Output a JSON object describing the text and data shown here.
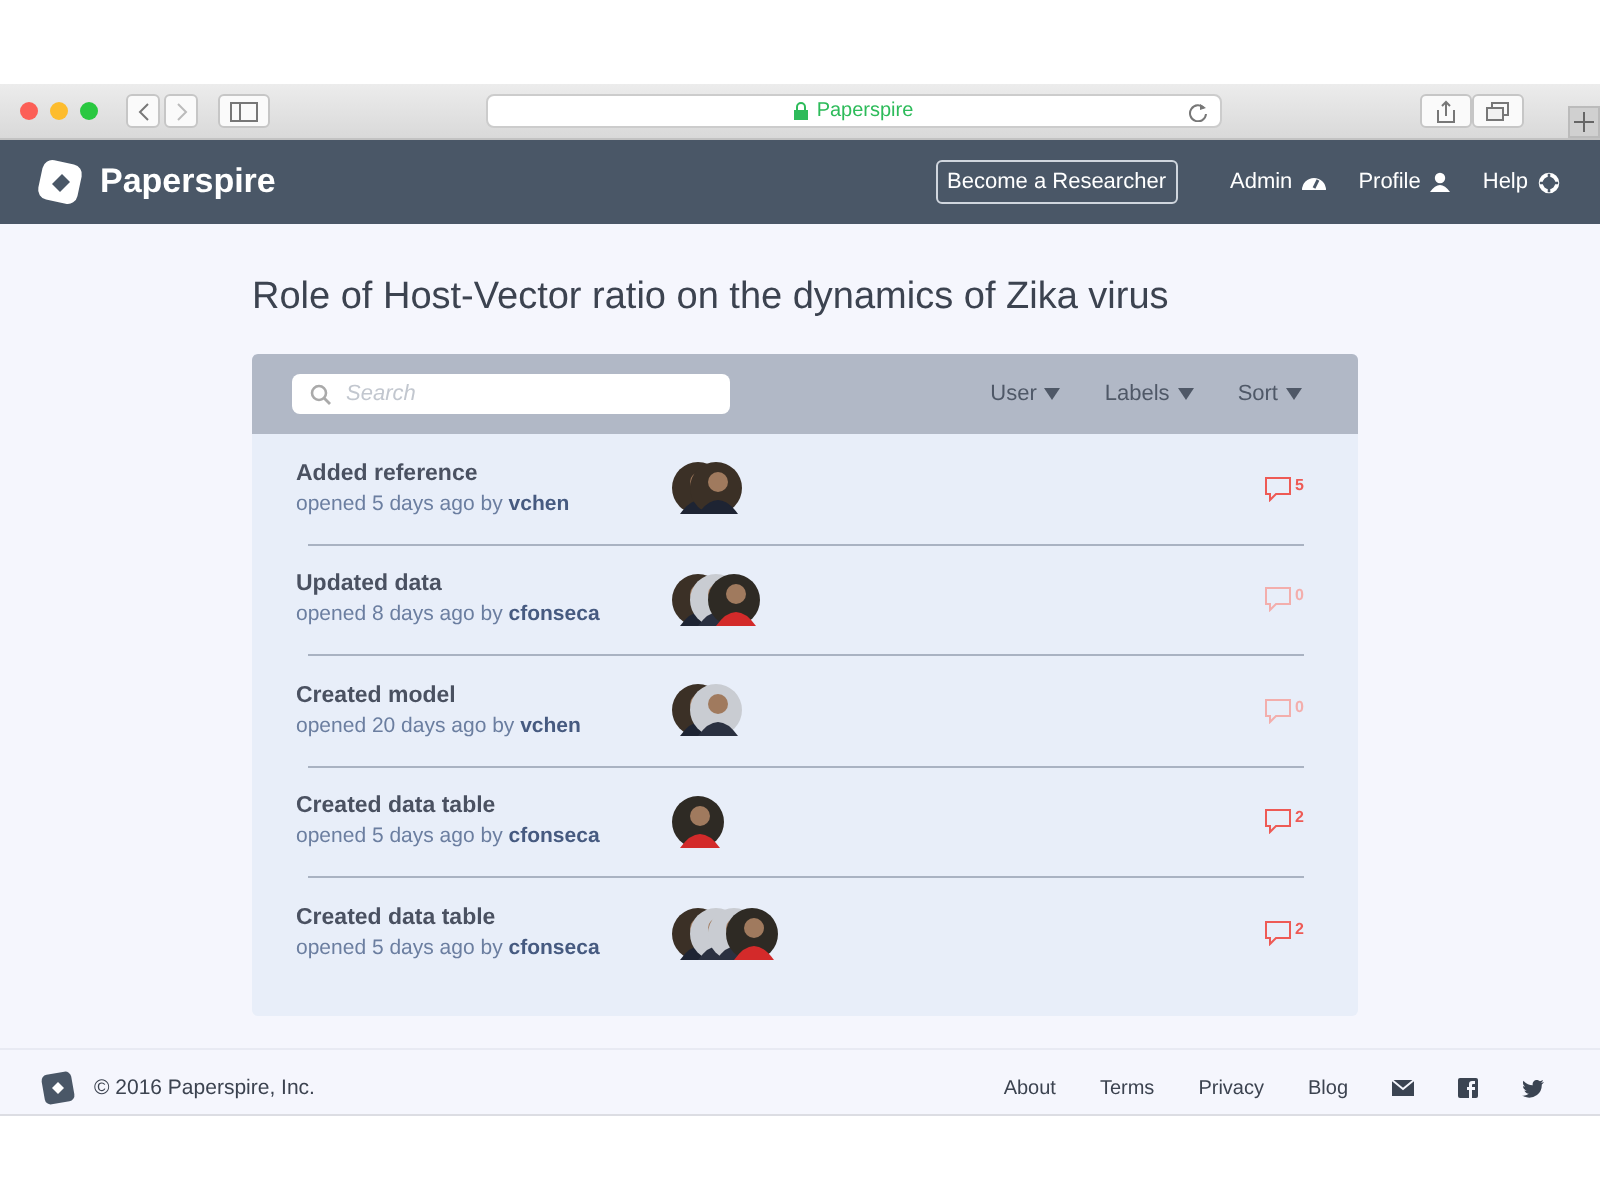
{
  "browser": {
    "address": "Paperspire"
  },
  "navbar": {
    "brand": "Paperspire",
    "cta": "Become a Researcher",
    "links": [
      {
        "label": "Admin",
        "kind": "dashboard"
      },
      {
        "label": "Profile",
        "kind": "user"
      },
      {
        "label": "Help",
        "kind": "lifebuoy"
      }
    ]
  },
  "page": {
    "title": "Role of Host-Vector ratio on the dynamics of Zika virus"
  },
  "toolbar": {
    "search": {
      "placeholder": "Search"
    },
    "filters": [
      "User",
      "Labels",
      "Sort"
    ]
  },
  "activities": [
    {
      "title": "Added reference",
      "meta": "opened 5 days ago by",
      "author": "vchen",
      "avatars": [
        {
          "kind": "dark"
        },
        {
          "kind": "dark"
        }
      ],
      "comments": "5",
      "muted": false
    },
    {
      "title": "Updated data",
      "meta": "opened 8 days ago by",
      "author": "cfonseca",
      "avatars": [
        {
          "kind": "dark"
        },
        {
          "kind": "light"
        },
        {
          "kind": "scarf"
        }
      ],
      "comments": "0",
      "muted": true
    },
    {
      "title": "Created model",
      "meta": "opened 20 days ago by",
      "author": "vchen",
      "avatars": [
        {
          "kind": "dark"
        },
        {
          "kind": "light"
        }
      ],
      "comments": "0",
      "muted": true
    },
    {
      "title": "Created data table",
      "meta": "opened 5 days ago by",
      "author": "cfonseca",
      "avatars": [
        {
          "kind": "scarf"
        }
      ],
      "comments": "2",
      "muted": false
    },
    {
      "title": "Created data table",
      "meta": "opened 5 days ago by",
      "author": "cfonseca",
      "avatars": [
        {
          "kind": "dark"
        },
        {
          "kind": "light"
        },
        {
          "kind": "light"
        },
        {
          "kind": "scarf"
        }
      ],
      "comments": "2",
      "muted": false
    }
  ],
  "footer": {
    "copyright": "© 2016 Paperspire, Inc.",
    "links": [
      "About",
      "Terms",
      "Privacy",
      "Blog"
    ],
    "social": [
      {
        "kind": "mail"
      },
      {
        "kind": "facebook"
      },
      {
        "kind": "twitter"
      }
    ]
  }
}
